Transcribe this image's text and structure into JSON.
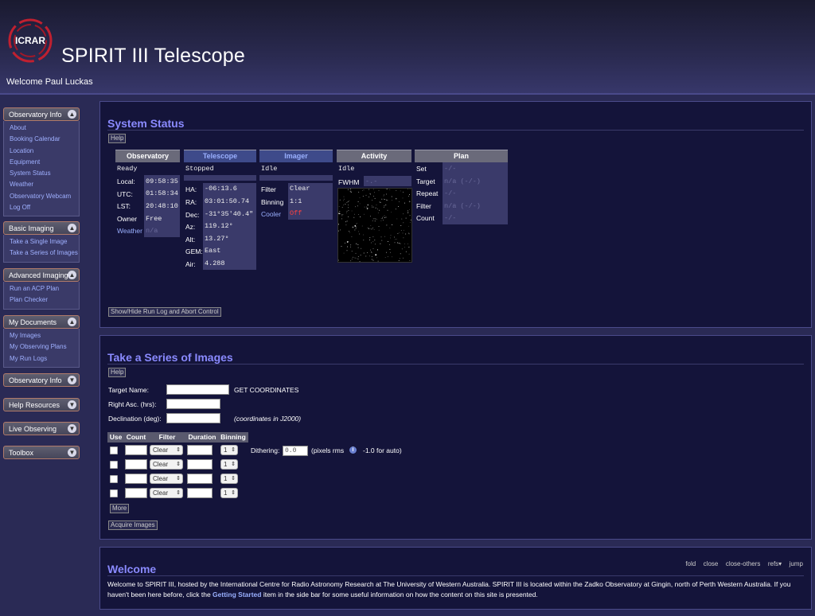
{
  "header": {
    "logo_text": "ICRAR",
    "title": "SPIRIT III Telescope",
    "welcome": "Welcome Paul Luckas"
  },
  "sidebar": [
    {
      "title": "Observatory Info",
      "expanded": true,
      "items": [
        "About",
        "Booking Calendar",
        "Location",
        "Equipment",
        "System Status",
        "Weather",
        "Observatory Webcam",
        "Log Off"
      ]
    },
    {
      "title": "Basic Imaging",
      "expanded": true,
      "items": [
        "Take a Single Image",
        "Take a Series of Images"
      ]
    },
    {
      "title": "Advanced Imaging",
      "expanded": true,
      "items": [
        "Run an ACP Plan",
        "Plan Checker"
      ]
    },
    {
      "title": "My Documents",
      "expanded": true,
      "items": [
        "My Images",
        "My Observing Plans",
        "My Run Logs"
      ]
    },
    {
      "title": "Observatory Info",
      "expanded": false,
      "items": []
    },
    {
      "title": "Help Resources",
      "expanded": false,
      "items": []
    },
    {
      "title": "Live Observing",
      "expanded": false,
      "items": []
    },
    {
      "title": "Toolbox",
      "expanded": false,
      "items": []
    }
  ],
  "status": {
    "title": "System Status",
    "help": "Help",
    "observatory": {
      "head": "Observatory",
      "state": "Ready",
      "local_label": "Local:",
      "local": "09:58:35",
      "utc_label": "UTC:",
      "utc": "01:58:34",
      "lst_label": "LST:",
      "lst": "20:48:10",
      "owner_label": "Owner",
      "owner": "Free",
      "weather_label": "Weather",
      "weather": "n/a"
    },
    "telescope": {
      "head": "Telescope",
      "state": "Stopped",
      "ha_label": "HA:",
      "ha": "-06:13.6",
      "ra_label": "RA:",
      "ra": "03:01:50.74",
      "dec_label": "Dec:",
      "dec": "-31°35'40.4\"",
      "az_label": "Az:",
      "az": "119.12°",
      "alt_label": "Alt:",
      "alt": "13.27°",
      "gem_label": "GEM:",
      "gem": "East",
      "air_label": "Air:",
      "air": "4.288"
    },
    "imager": {
      "head": "Imager",
      "state": "Idle",
      "filter_label": "Filter",
      "filter": "Clear",
      "binning_label": "Binning",
      "binning": "1:1",
      "cooler_label": "Cooler",
      "cooler": "Off"
    },
    "activity": {
      "head": "Activity",
      "state": "Idle",
      "fwhm_label": "FWHM",
      "fwhm": "-.-"
    },
    "plan": {
      "head": "Plan",
      "set_label": "Set",
      "set": "-/-",
      "target_label": "Target",
      "target": "n/a (-/-)",
      "repeat_label": "Repeat",
      "repeat": "-/-",
      "filter_label": "Filter",
      "filter": "n/a (-/-)",
      "count_label": "Count",
      "count": "-/-"
    },
    "runlog_button": "Show/Hide Run Log and Abort Control"
  },
  "series": {
    "title": "Take a Series of Images",
    "help": "Help",
    "target_label": "Target Name:",
    "get_coords": "GET COORDINATES",
    "ra_label": "Right Asc. (hrs):",
    "dec_label": "Declination (deg):",
    "coords_note": "(coordinates in J2000)",
    "columns": [
      "Use",
      "Count",
      "Filter",
      "Duration",
      "Binning"
    ],
    "rows": [
      {
        "filter": "Clear",
        "binning": "1"
      },
      {
        "filter": "Clear",
        "binning": "1"
      },
      {
        "filter": "Clear",
        "binning": "1"
      },
      {
        "filter": "Clear",
        "binning": "1"
      }
    ],
    "dithering_label": "Dithering:",
    "dithering_value": "0.0",
    "dithering_units": "(pixels rms",
    "dithering_hint": "-1.0 for auto)",
    "more": "More",
    "acquire": "Acquire Images"
  },
  "welcome": {
    "toolbar": [
      "fold",
      "close",
      "close-others",
      "refs▾",
      "jump"
    ],
    "title": "Welcome",
    "text1": "Welcome to SPIRIT III, hosted by the International Centre for Radio Astronomy Research at The University of Western Australia. SPIRIT III is located within the Zadko Observatory at Gingin, north of Perth Western Australia. If you haven't been here before, click the ",
    "link": "Getting Started",
    "text2": " item in the side bar for some useful information on how the content on this site is presented."
  }
}
